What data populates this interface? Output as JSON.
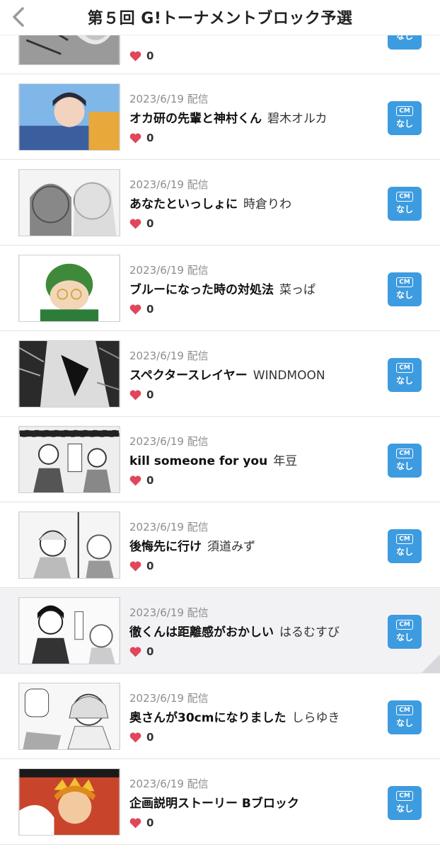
{
  "header": {
    "title": "第５回 G!トーナメントブロック予選",
    "back_icon": "chevron-left-icon"
  },
  "cm_badge": {
    "label": "CM",
    "sub": "なし",
    "color": "#3d9be0"
  },
  "items": [
    {
      "date": "",
      "title": "",
      "author": "",
      "likes": "0"
    },
    {
      "date": "2023/6/19 配信",
      "title": "オカ研の先輩と神村くん",
      "author": "碧木オルカ",
      "likes": "0"
    },
    {
      "date": "2023/6/19 配信",
      "title": "あなたといっしょに",
      "author": "時倉りわ",
      "likes": "0"
    },
    {
      "date": "2023/6/19 配信",
      "title": "ブルーになった時の対処法",
      "author": "菜っぱ",
      "likes": "0"
    },
    {
      "date": "2023/6/19 配信",
      "title": "スペクタースレイヤー",
      "author": "WINDMOON",
      "likes": "0"
    },
    {
      "date": "2023/6/19 配信",
      "title": "kill someone for you",
      "author": "年豆",
      "likes": "0"
    },
    {
      "date": "2023/6/19 配信",
      "title": "後悔先に行け",
      "author": "須道みず",
      "likes": "0"
    },
    {
      "date": "2023/6/19 配信",
      "title": "徹くんは距離感がおかしい",
      "author": "はるむすび",
      "likes": "0"
    },
    {
      "date": "2023/6/19 配信",
      "title": "奥さんが30cmになりました",
      "author": "しらゆき",
      "likes": "0"
    },
    {
      "date": "2023/6/19 配信",
      "title": "企画説明ストーリー Bブロック",
      "author": "",
      "likes": "0"
    }
  ]
}
